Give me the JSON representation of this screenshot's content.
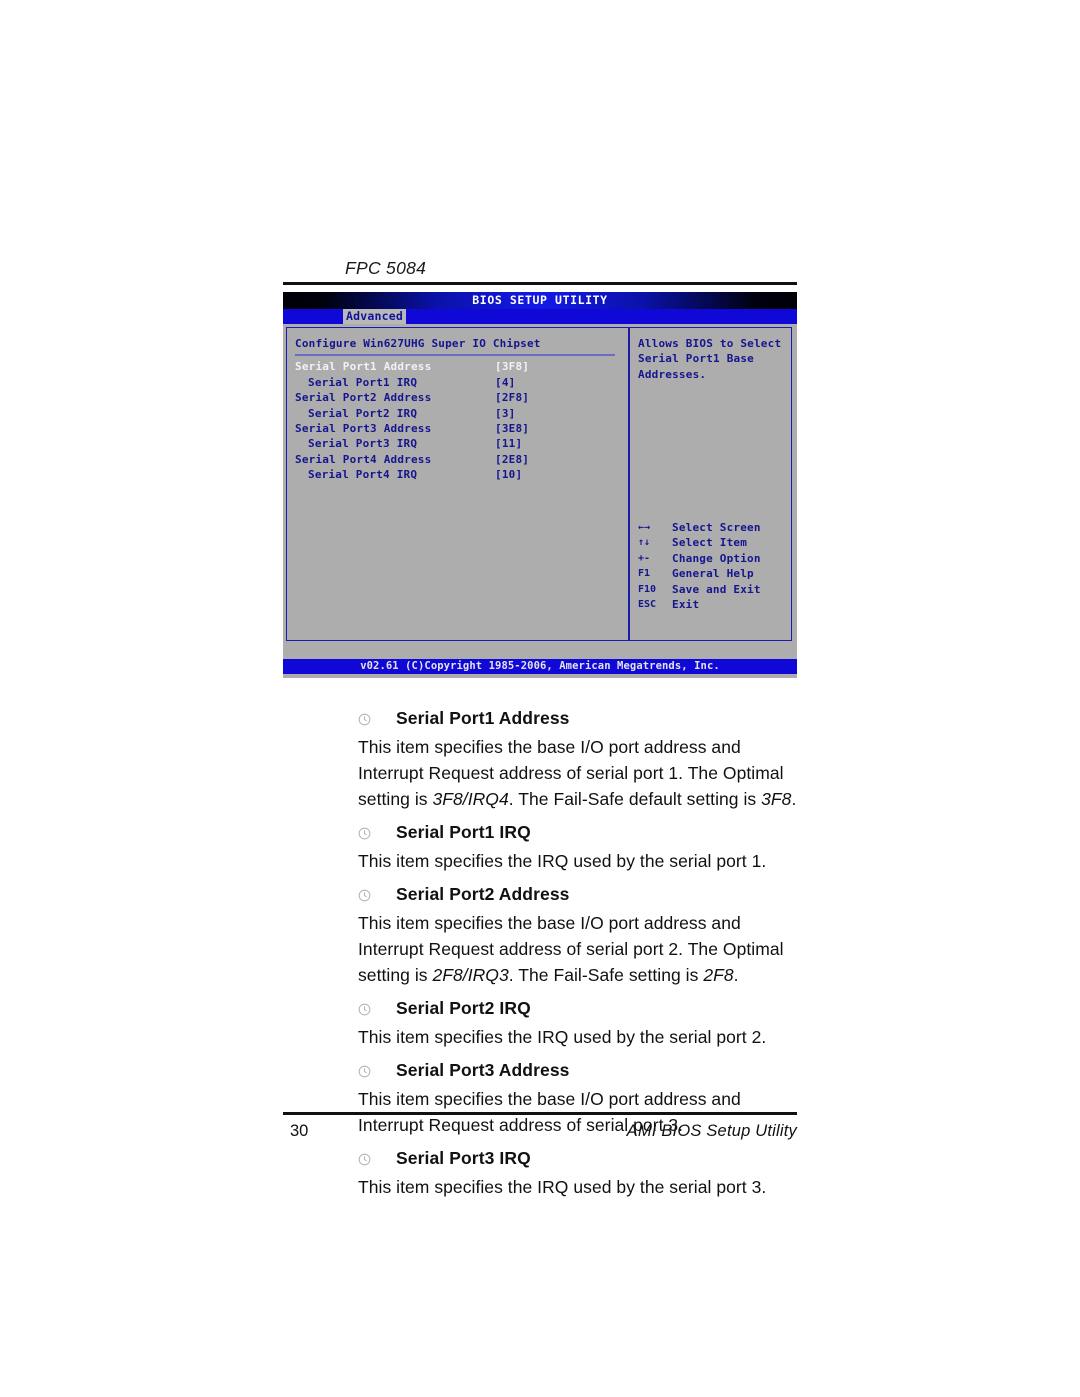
{
  "document": {
    "running_head": "FPC 5084",
    "page_number": "30",
    "footer_label": "AMI BIOS Setup Utility"
  },
  "bios": {
    "title": "BIOS SETUP UTILITY",
    "active_tab": "Advanced",
    "section_header": "Configure Win627UHG Super IO Chipset",
    "options": [
      {
        "label": "Serial Port1 Address",
        "value": "[3F8]",
        "indent": false,
        "selected": true
      },
      {
        "label": "Serial Port1 IRQ",
        "value": "[4]",
        "indent": true,
        "selected": false
      },
      {
        "label": "Serial Port2 Address",
        "value": "[2F8]",
        "indent": false,
        "selected": false
      },
      {
        "label": "Serial Port2 IRQ",
        "value": "[3]",
        "indent": true,
        "selected": false
      },
      {
        "label": "Serial Port3 Address",
        "value": "[3E8]",
        "indent": false,
        "selected": false
      },
      {
        "label": "Serial Port3 IRQ",
        "value": "[11]",
        "indent": true,
        "selected": false
      },
      {
        "label": "Serial Port4 Address",
        "value": "[2E8]",
        "indent": false,
        "selected": false
      },
      {
        "label": "Serial Port4 IRQ",
        "value": "[10]",
        "indent": true,
        "selected": false
      }
    ],
    "help": [
      "Allows BIOS to Select",
      "Serial Port1 Base",
      "Addresses."
    ],
    "keys": [
      {
        "glyph": "←→",
        "desc": "Select Screen"
      },
      {
        "glyph": "↑↓",
        "desc": "Select Item"
      },
      {
        "glyph": "+-",
        "desc": "Change Option"
      },
      {
        "glyph": "F1",
        "desc": "General Help"
      },
      {
        "glyph": "F10",
        "desc": "Save and Exit"
      },
      {
        "glyph": "ESC",
        "desc": "Exit"
      }
    ],
    "footer": "v02.61 (C)Copyright 1985-2006, American Megatrends, Inc.",
    "colors": {
      "panel_bg": "#adadad",
      "accent_blue": "#1008d6",
      "text_blue": "#15158f",
      "selected_text": "#f2f2f2",
      "rule_purple": "#6b6bc8"
    }
  },
  "sections": [
    {
      "title": "Serial Port1 Address",
      "body_html": "This item specifies the base I/O port address and Interrupt Request address of serial port 1. The Optimal setting is <i>3F8/IRQ4</i>. The Fail-Safe default setting is <i>3F8</i>."
    },
    {
      "title": "Serial Port1 IRQ",
      "body_html": "This item specifies the IRQ used by the serial port 1."
    },
    {
      "title": "Serial Port2 Address",
      "body_html": "This item specifies the base I/O port address and Interrupt Request address of serial port 2. The Optimal setting is <i>2F8/IRQ3</i>. The Fail-Safe setting is <i>2F8</i>."
    },
    {
      "title": "Serial Port2 IRQ",
      "body_html": "This item specifies the IRQ used by the serial port 2."
    },
    {
      "title": "Serial Port3 Address",
      "body_html": "This item specifies the base I/O port address and Interrupt Request address of serial port 3."
    },
    {
      "title": "Serial Port3 IRQ",
      "body_html": "This item specifies the IRQ used by the serial port 3."
    }
  ]
}
